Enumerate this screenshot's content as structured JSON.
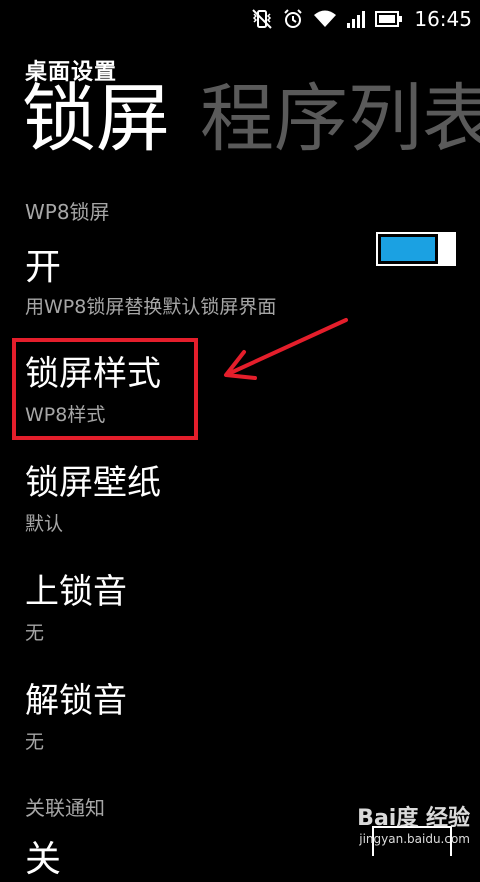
{
  "status_bar": {
    "time": "16:45",
    "icons": [
      "vibrate-muted-icon",
      "alarm-icon",
      "wifi-icon",
      "signal-icon",
      "battery-icon"
    ]
  },
  "app_title": "桌面设置",
  "pivot": {
    "active_tab": "锁屏",
    "next_tab": "程序列表"
  },
  "wp8_lockscreen": {
    "label": "WP8锁屏",
    "state": "开",
    "description": "用WP8锁屏替换默认锁屏界面",
    "enabled": true
  },
  "settings": [
    {
      "title": "锁屏样式",
      "value": "WP8样式"
    },
    {
      "title": "锁屏壁纸",
      "value": "默认"
    },
    {
      "title": "上锁音",
      "value": "无"
    },
    {
      "title": "解锁音",
      "value": "无"
    }
  ],
  "linked_notifications": {
    "label": "关联通知",
    "state": "关"
  },
  "colors": {
    "accent": "#1ba1e2",
    "highlight": "#e41e2b",
    "secondary_text": "#a6a6a6"
  },
  "watermark": {
    "logo": "Bai度 经验",
    "url": "jingyan.baidu.com"
  }
}
